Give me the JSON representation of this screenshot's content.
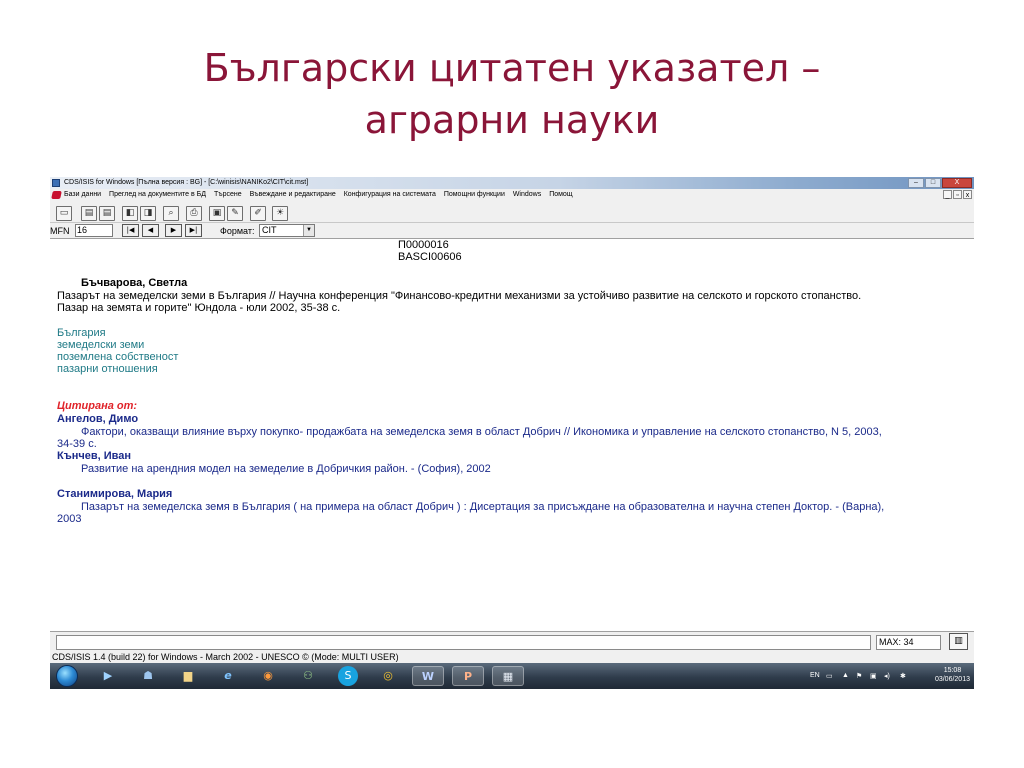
{
  "slide": {
    "title_line1": "Български цитатен указател –",
    "title_line2": "аграрни науки"
  },
  "window": {
    "title": "CDS/ISIS for Windows [Пълна версия : BG] - [C:\\winisis\\NANIKo2\\CIT\\cit.mst]",
    "controls": {
      "minimize": "–",
      "maximize": "□",
      "close": "X"
    }
  },
  "menubar": {
    "items": [
      "Бази данни",
      "Преглед на документите в БД",
      "Търсене",
      "Въвеждане и редактиране",
      "Конфигурация на системата",
      "Помощни функции",
      "Windows",
      "Помощ"
    ],
    "mdi_controls": {
      "minimize": "_",
      "restore": "▫",
      "close": "x"
    }
  },
  "toolbar": {
    "buttons": [
      {
        "icon": "open-folder-icon",
        "glyph": "▭"
      },
      {
        "icon": "database-icon",
        "glyph": "▤"
      },
      {
        "icon": "database2-icon",
        "glyph": "▤"
      },
      {
        "icon": "browse-icon",
        "glyph": "◧"
      },
      {
        "icon": "browse-multi-icon",
        "glyph": "◨"
      },
      {
        "icon": "search-icon",
        "glyph": "⌕"
      },
      {
        "icon": "print-icon",
        "glyph": "⎙"
      },
      {
        "icon": "display-icon",
        "glyph": "▣"
      },
      {
        "icon": "edit-icon",
        "glyph": "✎"
      },
      {
        "icon": "pencil-icon",
        "glyph": "✐"
      },
      {
        "icon": "lightbulb-icon",
        "glyph": "☀"
      }
    ]
  },
  "navbar": {
    "mfn_label": "MFN",
    "mfn_value": "16",
    "nav_buttons": [
      {
        "icon": "first-record-icon",
        "glyph": "|◀"
      },
      {
        "icon": "prev-record-icon",
        "glyph": "◀"
      },
      {
        "icon": "next-record-icon",
        "glyph": "▶"
      },
      {
        "icon": "last-record-icon",
        "glyph": "▶|"
      }
    ],
    "format_label": "Формат:",
    "format_value": "CIT"
  },
  "record": {
    "id1": "П0000016",
    "id2": "BASCI00606",
    "author": "Бъчварова, Светла",
    "text_line1": "Пазарът на земеделски земи в България // Научна конференция \"Финансово-кредитни механизми за устойчиво развитие на селското и горското стопанство.",
    "text_line2": "Пазар на земята и горите\" Юндола - юли 2002, 35-38 с.",
    "keywords": [
      "България",
      "земеделски земи",
      "поземлена собственост",
      "пазарни отношения"
    ],
    "cited_heading": "Цитирана от:",
    "citations": [
      {
        "author": "Ангелов, Димо",
        "title": "Фактори, оказващи влияние върху покупко- продажбата на земеделска земя в област Добрич // Икономика и управление на селското стопанство, N 5,  2003,",
        "continuation": "34-39 с."
      },
      {
        "author": "Кънчев, Иван",
        "title": "Развитие на арендния модел на земеделие в Добричкия район. - (София), 2002",
        "continuation": ""
      },
      {
        "author": "Станимирова, Мария",
        "title": "Пазарът на земеделска земя в България ( на примера на област Добрич ) : Дисертация за присъждане на образователна и научна степен Доктор. - (Варна),",
        "continuation": "2003"
      }
    ]
  },
  "inputbar": {
    "command_value": "",
    "max_label": "MAX: 34"
  },
  "statusbar": {
    "text": "CDS/ISIS 1.4 (build 22) for Windows - March 2002 - UNESCO ©  (Mode: MULTI USER)"
  },
  "taskbar": {
    "apps": [
      {
        "name": "media-player-icon",
        "glyph": "▶"
      },
      {
        "name": "user-icon",
        "glyph": "☗"
      },
      {
        "name": "explorer-folder-icon",
        "glyph": "▆"
      },
      {
        "name": "internet-explorer-icon",
        "glyph": "e"
      },
      {
        "name": "firefox-icon",
        "glyph": "◉"
      },
      {
        "name": "network-icon",
        "glyph": "⚇"
      },
      {
        "name": "skype-icon",
        "glyph": "S"
      },
      {
        "name": "chrome-icon",
        "glyph": "◎"
      },
      {
        "name": "word-icon",
        "glyph": "W"
      },
      {
        "name": "powerpoint-icon",
        "glyph": "P"
      },
      {
        "name": "winisis-icon",
        "glyph": "▦"
      }
    ],
    "tray_lang": "EN",
    "clock_time": "15:08",
    "clock_date": "03/06/2013"
  },
  "colors": {
    "slide_title": "#8a1538",
    "keyword": "#1f7a86",
    "cited_heading": "#e0242a",
    "citation": "#1b2a8a"
  }
}
